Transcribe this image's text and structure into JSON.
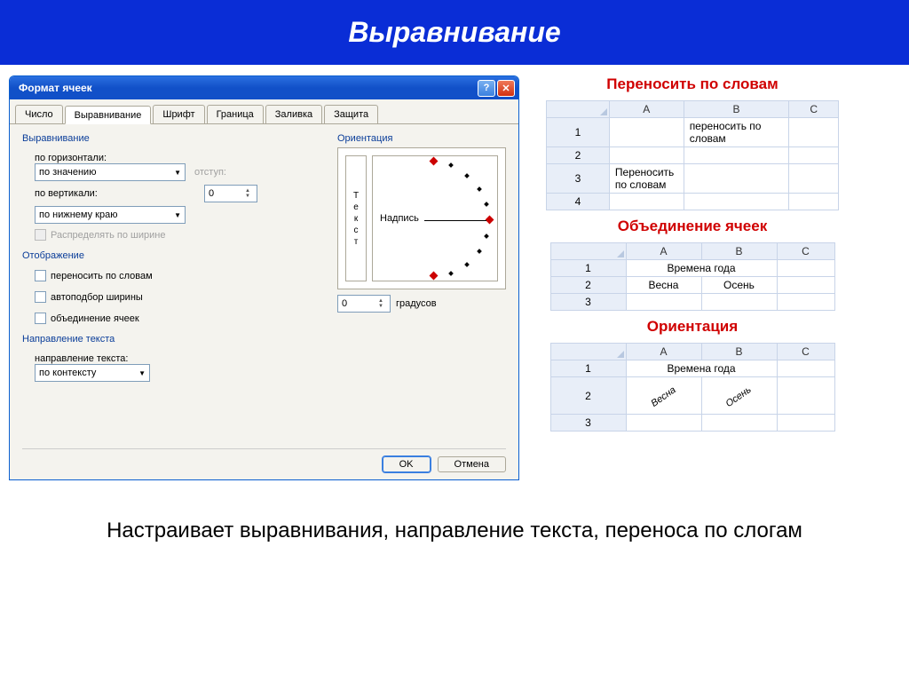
{
  "banner": {
    "title": "Выравнивание"
  },
  "dialog": {
    "title": "Формат ячеек",
    "tabs": [
      "Число",
      "Выравнивание",
      "Шрифт",
      "Граница",
      "Заливка",
      "Защита"
    ],
    "alignment_section": "Выравнивание",
    "horiz_label": "по горизонтали:",
    "horiz_value": "по значению",
    "indent_label": "отступ:",
    "indent_value": "0",
    "vert_label": "по вертикали:",
    "vert_value": "по нижнему краю",
    "distribute": "Распределять по ширине",
    "display_section": "Отображение",
    "wrap": "переносить по словам",
    "shrink": "автоподбор ширины",
    "merge": "объединение ячеек",
    "direction_section": "Направление текста",
    "direction_label": "направление текста:",
    "direction_value": "по контексту",
    "orientation_section": "Ориентация",
    "orient_vert_text": "Текст",
    "orient_arc_label": "Надпись",
    "degrees_value": "0",
    "degrees_label": "градусов",
    "ok": "OK",
    "cancel": "Отмена"
  },
  "examples": {
    "wrap_title": "Переносить по словам",
    "wrap_cols": [
      "A",
      "B",
      "C"
    ],
    "wrap_b1": "переносить по словам",
    "wrap_a3": "Переносить по словам",
    "merge_title": "Объединение ячеек",
    "merge_cols": [
      "A",
      "B",
      "C"
    ],
    "merge_ab1": "Времена года",
    "merge_a2": "Весна",
    "merge_b2": "Осень",
    "orient_title": "Ориентация",
    "orient_cols": [
      "A",
      "B",
      "C"
    ],
    "orient_ab1": "Времена года",
    "orient_a2": "Весна",
    "orient_b2": "Осень"
  },
  "footer": "Настраивает выравнивания, направление текста, переноса по слогам"
}
